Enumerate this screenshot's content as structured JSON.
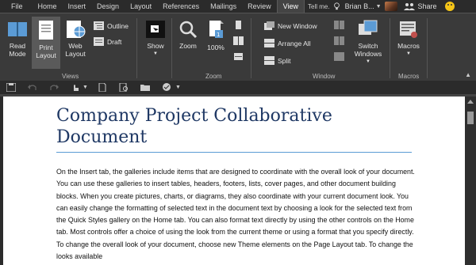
{
  "tabs": [
    {
      "label": "File"
    },
    {
      "label": "Home"
    },
    {
      "label": "Insert"
    },
    {
      "label": "Design"
    },
    {
      "label": "Layout"
    },
    {
      "label": "References"
    },
    {
      "label": "Mailings"
    },
    {
      "label": "Review"
    },
    {
      "label": "View"
    }
  ],
  "tell_me": "Tell me.",
  "user_name": "Brian B...",
  "share_label": "Share",
  "ribbon": {
    "views": {
      "read_mode": "Read Mode",
      "print_layout": "Print Layout",
      "web_layout": "Web Layout",
      "outline": "Outline",
      "draft": "Draft",
      "group_label": "Views"
    },
    "show": {
      "label": "Show"
    },
    "zoom": {
      "zoom_label": "Zoom",
      "hundred_label": "100%",
      "group_label": "Zoom"
    },
    "window": {
      "new_window": "New Window",
      "arrange_all": "Arrange All",
      "split": "Split",
      "switch_windows": "Switch Windows",
      "group_label": "Window"
    },
    "macros": {
      "label": "Macros",
      "group_label": "Macros"
    }
  },
  "document": {
    "title": "Company Project Collaborative Document",
    "body": "On the Insert tab, the galleries include items that are designed to coordinate with the overall look of your document. You can use these galleries to insert tables, headers, footers, lists, cover pages, and other document building blocks. When you create pictures, charts, or diagrams, they also coordinate with your current document look. You can easily change the formatting of selected text in the document text by choosing a look for the selected text from the Quick Styles gallery on the Home tab. You can also format text directly by using the other controls on the Home tab. Most controls offer a choice of using the look from the current theme or using a format that you specify directly. To change the overall look of your document, choose new Theme elements on the Page Layout tab. To change the looks available"
  },
  "colors": {
    "title": "#1f3864",
    "title_rule": "#5b9bd5",
    "ribbon_bg": "#3a3a3a",
    "tabbar_bg": "#2b2b2b"
  }
}
